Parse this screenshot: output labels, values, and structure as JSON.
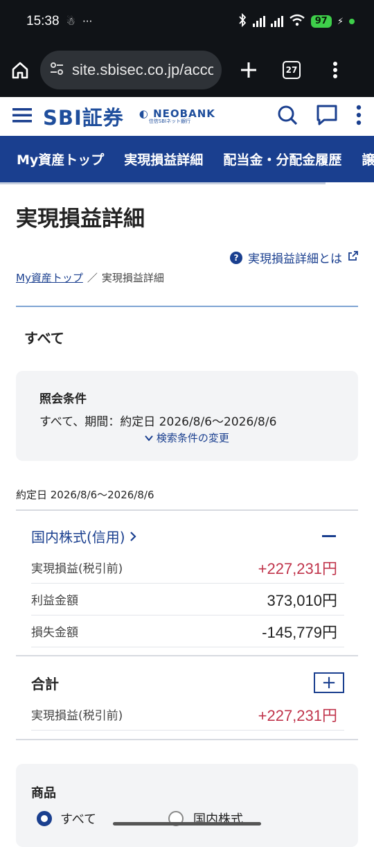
{
  "status": {
    "time": "15:38",
    "battery": "97"
  },
  "browser": {
    "url": "site.sbisec.co.jp/acco",
    "tab_count": "27"
  },
  "header": {
    "logo": "SBI証券",
    "partner_logo": "NEOBANK",
    "partner_sub": "住信SBIネット銀行"
  },
  "nav": {
    "items": [
      "My資産トップ",
      "実現損益詳細",
      "配当金・分配金履歴",
      "譲"
    ]
  },
  "page": {
    "title": "実現損益詳細",
    "help_link": "実現損益詳細とは",
    "breadcrumb": {
      "home": "My資産トップ",
      "sep": "／",
      "current": "実現損益詳細"
    },
    "subtitle": "すべて"
  },
  "conditions": {
    "label": "照会条件",
    "desc": "すべて、期間：約定日 2026/8/6〜2026/8/6",
    "change_link": "検索条件の変更"
  },
  "period_label": "約定日 2026/8/6〜2026/8/6",
  "domestic": {
    "title": "国内株式(信用)",
    "rows": [
      {
        "label": "実現損益(税引前)",
        "value": "+227,231円"
      },
      {
        "label": "利益金額",
        "value": "373,010円"
      },
      {
        "label": "損失金額",
        "value": "-145,779円"
      }
    ]
  },
  "total": {
    "title": "合計",
    "rows": [
      {
        "label": "実現損益(税引前)",
        "value": "+227,231円"
      }
    ]
  },
  "product": {
    "label": "商品",
    "options": [
      "すべて",
      "国内株式"
    ]
  },
  "colors": {
    "brand": "#1a3f8f",
    "positive": "#c0344b"
  }
}
